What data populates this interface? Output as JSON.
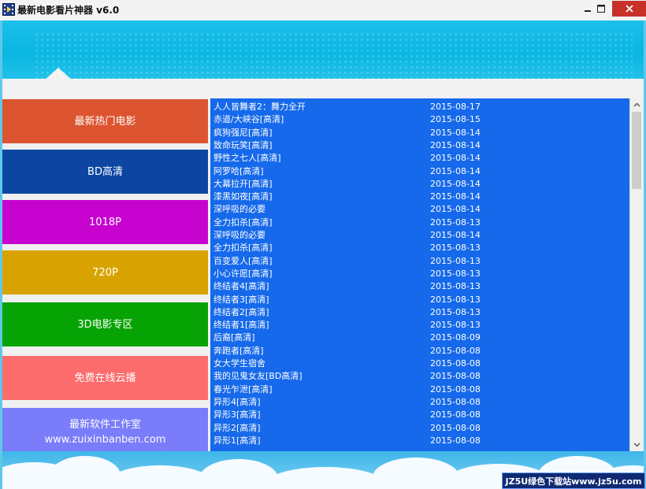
{
  "window": {
    "title": "最新电影看片神器 v6.0",
    "min_icon": "minimize-icon",
    "max_icon": "maximize-icon",
    "close_icon": "close-icon"
  },
  "menu": [
    {
      "label": "最新热门电影",
      "color": "#dc5430"
    },
    {
      "label": "BD高清",
      "color": "#0c46a2"
    },
    {
      "label": "1018P",
      "color": "#c704cf"
    },
    {
      "label": "720P",
      "color": "#d8a300"
    },
    {
      "label": "3D电影专区",
      "color": "#07a305"
    },
    {
      "label": "免费在线云播",
      "color": "#fd6c6c"
    },
    {
      "label": "最新软件工作室",
      "sub": "www.zuixinbanben.com",
      "color": "#7a7cfa"
    }
  ],
  "movies": [
    {
      "title": "人人皆舞者2：舞力全开",
      "date": "2015-08-17"
    },
    {
      "title": "赤道/大峡谷[高清]",
      "date": "2015-08-15"
    },
    {
      "title": "疯狗强尼[高清]",
      "date": "2015-08-14"
    },
    {
      "title": "致命玩笑[高清]",
      "date": "2015-08-14"
    },
    {
      "title": "野性之七人[高清]",
      "date": "2015-08-14"
    },
    {
      "title": "阿罗哈[高清]",
      "date": "2015-08-14"
    },
    {
      "title": "大幕拉开[高清]",
      "date": "2015-08-14"
    },
    {
      "title": "漆黑如夜[高清]",
      "date": "2015-08-14"
    },
    {
      "title": "深呼吸的必要",
      "date": "2015-08-14"
    },
    {
      "title": "全力扣杀[高清]",
      "date": "2015-08-13"
    },
    {
      "title": "深呼吸的必要",
      "date": "2015-08-14"
    },
    {
      "title": "全力扣杀[高清]",
      "date": "2015-08-13"
    },
    {
      "title": "百变爱人[高清]",
      "date": "2015-08-13"
    },
    {
      "title": "小心许愿[高清]",
      "date": "2015-08-13"
    },
    {
      "title": "终结者4[高清]",
      "date": "2015-08-13"
    },
    {
      "title": "终结者3[高清]",
      "date": "2015-08-13"
    },
    {
      "title": "终结者2[高清]",
      "date": "2015-08-13"
    },
    {
      "title": "终结者1[高清]",
      "date": "2015-08-13"
    },
    {
      "title": "后裔[高清]",
      "date": "2015-08-09"
    },
    {
      "title": "奔跑者[高清]",
      "date": "2015-08-08"
    },
    {
      "title": "女大学生宿舍",
      "date": "2015-08-08"
    },
    {
      "title": "我的见鬼女友[BD高清]",
      "date": "2015-08-08"
    },
    {
      "title": "春光乍泄[高清]",
      "date": "2015-08-08"
    },
    {
      "title": "异形4[高清]",
      "date": "2015-08-08"
    },
    {
      "title": "异形3[高清]",
      "date": "2015-08-08"
    },
    {
      "title": "异形2[高清]",
      "date": "2015-08-08"
    },
    {
      "title": "异形1[高清]",
      "date": "2015-08-08"
    }
  ],
  "colors": {
    "list_bg": "#1669ea",
    "banner": "#0ab6e2",
    "close_button": "#c7312a"
  },
  "watermark": "JZ5U绿色下载站www.jz5u.com"
}
